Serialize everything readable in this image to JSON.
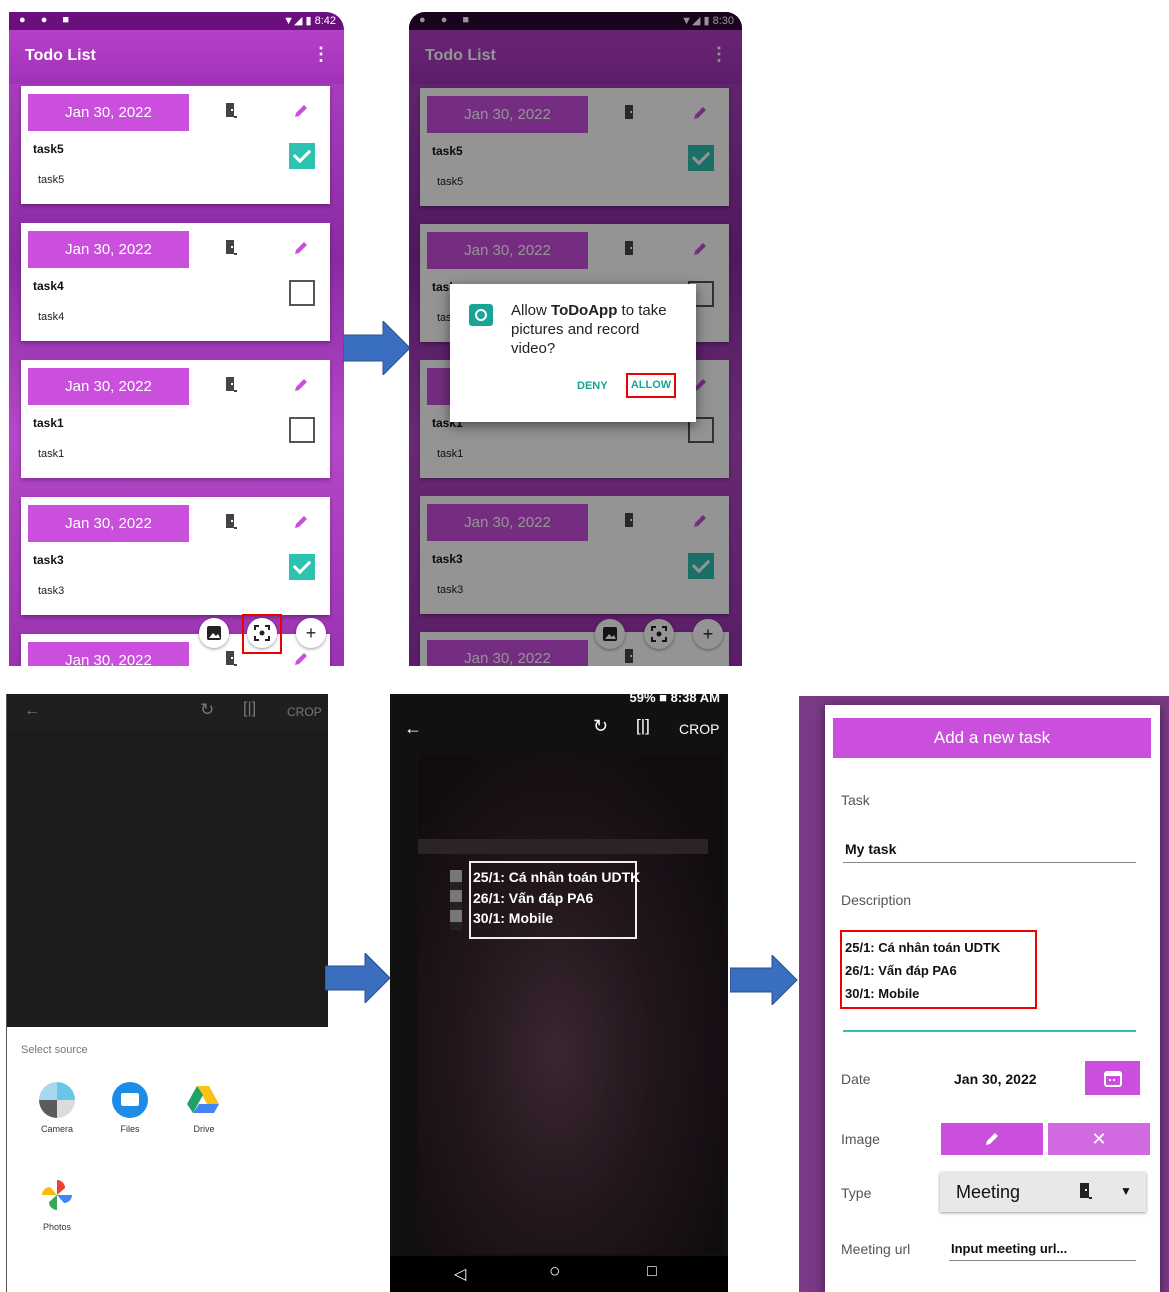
{
  "todo": {
    "status_left": "● ● ■",
    "time": "8:42",
    "title": "Todo List",
    "menu": "⋮",
    "tasks": [
      {
        "date": "Jan 30, 2022",
        "name": "task5",
        "desc": "task5",
        "done": true
      },
      {
        "date": "Jan 30, 2022",
        "name": "task4",
        "desc": "task4",
        "done": false
      },
      {
        "date": "Jan 30, 2022",
        "name": "task1",
        "desc": "task1",
        "done": false
      },
      {
        "date": "Jan 30, 2022",
        "name": "task3",
        "desc": "task3",
        "done": true
      },
      {
        "date": "Jan 30, 2022"
      }
    ],
    "fab_add": "+"
  },
  "permission": {
    "time": "8:30",
    "title": "Todo List",
    "message_pre": "Allow ",
    "app_name": "ToDoApp",
    "message_post": " to take pictures and record video?",
    "deny": "DENY",
    "allow": "ALLOW",
    "partial_names": [
      "task",
      "tas"
    ]
  },
  "picker": {
    "crop": "CROP",
    "select_source": "Select source",
    "apps": [
      "Camera",
      "Files",
      "Drive",
      "Photos"
    ]
  },
  "cropper": {
    "status_right": "59% ■ 8:38 AM",
    "crop": "CROP",
    "ocr_lines": [
      "25/1: Cá nhân toán UDTK",
      "26/1: Vấn đáp PA6",
      "30/1: Mobile"
    ]
  },
  "add_task": {
    "header": "Add a new task",
    "task_label": "Task",
    "task_value": "My task",
    "desc_label": "Description",
    "desc_lines": [
      "25/1: Cá nhân toán UDTK",
      "26/1: Vấn đáp PA6",
      "30/1: Mobile"
    ],
    "date_label": "Date",
    "date_value": "Jan 30, 2022",
    "image_label": "Image",
    "type_label": "Type",
    "type_value": "Meeting",
    "meeting_label": "Meeting url",
    "meeting_value": "Input meeting url..."
  },
  "colors": {
    "accent": "#c94fdc",
    "appbar": "#a132b8",
    "teal": "#2ec2b0",
    "arrow": "#3a6fbf",
    "highlight": "#e00000"
  }
}
